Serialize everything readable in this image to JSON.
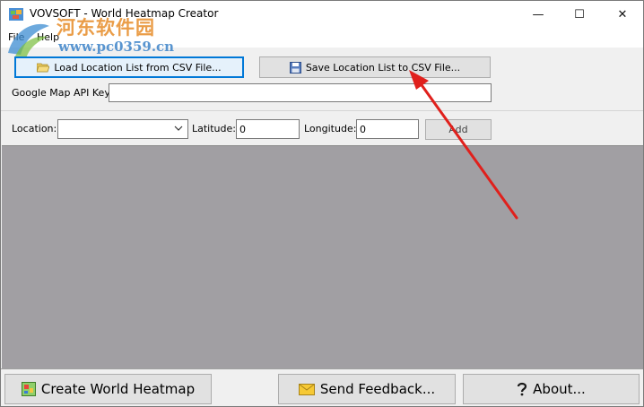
{
  "window": {
    "title": "VOVSOFT - World Heatmap Creator",
    "controls": {
      "minimize": "—",
      "maximize": "☐",
      "close": "✕"
    }
  },
  "menu": {
    "file": "File",
    "help": "Help"
  },
  "watermark": {
    "title": "河东软件园",
    "url": "www.pc0359.cn"
  },
  "toolbar": {
    "load_label": "Load Location List from CSV File...",
    "save_label": "Save Location List to CSV File..."
  },
  "api_key": {
    "label": "Google Map API Key:",
    "value": ""
  },
  "location_form": {
    "location_label": "Location:",
    "location_value": "",
    "latitude_label": "Latitude:",
    "latitude_value": "0",
    "longitude_label": "Longitude:",
    "longitude_value": "0",
    "add_label": "Add"
  },
  "footer": {
    "create_label": "Create World Heatmap",
    "feedback_label": "Send Feedback...",
    "about_label": "About..."
  },
  "colors": {
    "map_background": "#a19fa3",
    "annotation_arrow": "#e0201c",
    "focus_border": "#0078d7"
  },
  "icons": [
    "app-icon",
    "folder-open-icon",
    "floppy-disk-icon",
    "heatmap-icon",
    "envelope-icon",
    "question-icon"
  ]
}
